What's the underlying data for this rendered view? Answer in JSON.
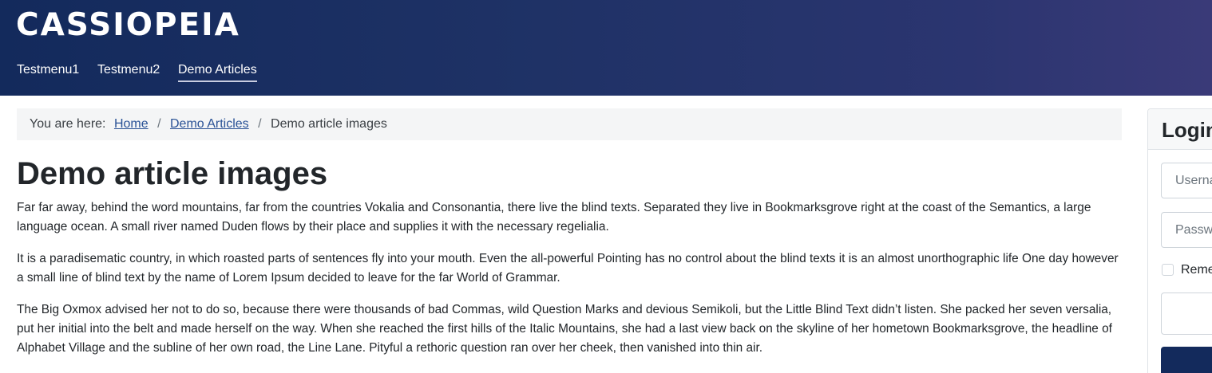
{
  "site": {
    "brand": "CASSIOPEIA"
  },
  "nav": {
    "items": [
      {
        "label": "Testmenu1"
      },
      {
        "label": "Testmenu2"
      },
      {
        "label": "Demo Articles",
        "active": true
      }
    ]
  },
  "breadcrumb": {
    "prefix": "You are here:",
    "separator": "/",
    "items": [
      {
        "label": "Home"
      },
      {
        "label": "Demo Articles"
      },
      {
        "label": "Demo article images"
      }
    ]
  },
  "article": {
    "title": "Demo article images",
    "paragraphs": [
      "Far far away, behind the word mountains, far from the countries Vokalia and Consonantia, there live the blind texts. Separated they live in Bookmarksgrove right at the coast of the Semantics, a large language ocean. A small river named Duden flows by their place and supplies it with the necessary regelialia.",
      "It is a paradisematic country, in which roasted parts of sentences fly into your mouth. Even the all-powerful Pointing has no control about the blind texts it is an almost unorthographic life One day however a small line of blind text by the name of Lorem Ipsum decided to leave for the far World of Grammar.",
      "The Big Oxmox advised her not to do so, because there were thousands of bad Commas, wild Question Marks and devious Semikoli, but the Little Blind Text didn’t listen. She packed her seven versalia, put her initial into the belt and made herself on the way. When she reached the first hills of the Italic Mountains, she had a last view back on the skyline of her hometown Bookmarksgrove, the headline of Alphabet Village and the subline of her own road, the Line Lane. Pityful a rethoric question ran over her cheek, then vanished into thin air."
    ]
  },
  "login": {
    "title": "Login",
    "username_placeholder": "Username",
    "password_placeholder": "Password",
    "remember_label": "Remember Me"
  },
  "colors": {
    "header_start": "#132a5c",
    "header_end": "#3a3a78",
    "link": "#2a5296",
    "button": "#132a5c"
  }
}
